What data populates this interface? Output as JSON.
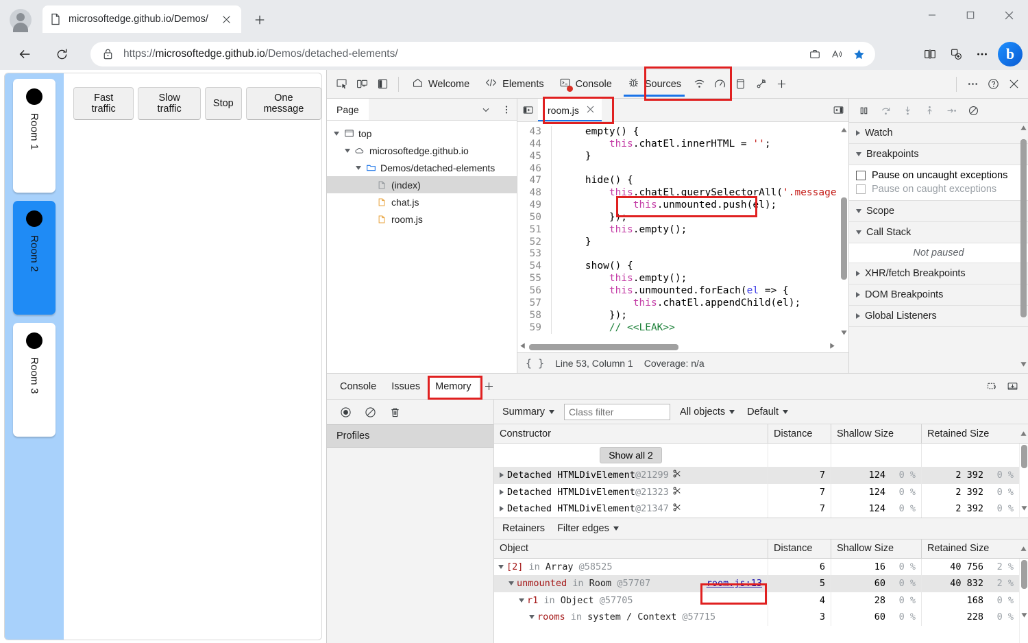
{
  "browser": {
    "tab": {
      "title": "microsoftedge.github.io/Demos/",
      "favicon_icon": "page-icon",
      "close_icon": "close-icon"
    },
    "new_tab_icon": "plus-icon",
    "window_controls": {
      "minimize": "minimize-icon",
      "maximize": "maximize-icon",
      "close": "close-icon"
    },
    "back_icon": "back-arrow-icon",
    "reload_icon": "reload-icon",
    "lock_icon": "lock-icon",
    "url": {
      "scheme": "https://",
      "host": "microsoftedge.github.io",
      "path": "/Demos/detached-elements/"
    },
    "omnibox_icons": [
      "briefcase-icon",
      "read-aloud-icon",
      "favorite-star-icon"
    ],
    "toolbar_icons": [
      "split-screen-icon",
      "collections-icon",
      "more-options-icon"
    ],
    "copilot_icon": "bing-copilot-icon"
  },
  "page": {
    "controls": [
      {
        "label": "Fast traffic"
      },
      {
        "label": "Slow traffic"
      },
      {
        "label": "Stop"
      },
      {
        "label": "One message"
      }
    ],
    "rooms": [
      {
        "label": "Room 1",
        "active": false
      },
      {
        "label": "Room 2",
        "active": true
      },
      {
        "label": "Room 3",
        "active": false
      }
    ],
    "rail_color": "#a8d1fb",
    "active_room_color": "#1f8bf5"
  },
  "devtools": {
    "left_icons": [
      "inspect-element-icon",
      "device-toolbar-icon",
      "dock-side-icon"
    ],
    "tabs": [
      {
        "label": "Welcome",
        "icon": "home-icon",
        "selected": false
      },
      {
        "label": "Elements",
        "icon": "code-brackets-icon",
        "selected": false
      },
      {
        "label": "Console",
        "icon": "console-error-icon",
        "selected": false
      },
      {
        "label": "Sources",
        "icon": "bug-icon",
        "selected": true
      }
    ],
    "extra_tab_icons": [
      "network-icon",
      "performance-icon",
      "application-icon",
      "dom-leak-icon",
      "add-panel-icon"
    ],
    "right_icons": [
      "more-tools-icon",
      "help-icon",
      "close-devtools-icon"
    ],
    "accent_color": "#1a73e8",
    "highlight_color": "#e02020",
    "sources": {
      "nav_tab": "Page",
      "nav_dropdown_icon": "chevron-down-icon",
      "nav_more_icon": "more-vertical-icon",
      "tree": [
        {
          "label": "top",
          "icon": "frame-icon",
          "depth": 0,
          "expanded": true,
          "selected": false
        },
        {
          "label": "microsoftedge.github.io",
          "icon": "cloud-icon",
          "depth": 1,
          "expanded": true,
          "selected": false
        },
        {
          "label": "Demos/detached-elements",
          "icon": "folder-icon",
          "depth": 2,
          "expanded": true,
          "selected": false
        },
        {
          "label": "(index)",
          "icon": "document-icon",
          "depth": 3,
          "expanded": null,
          "selected": true
        },
        {
          "label": "chat.js",
          "icon": "js-file-icon",
          "depth": 3,
          "expanded": null,
          "selected": false
        },
        {
          "label": "room.js",
          "icon": "js-file-icon",
          "depth": 3,
          "expanded": null,
          "selected": false
        }
      ],
      "editor_tab": {
        "label": "room.js",
        "close_icon": "close-icon"
      },
      "panel_toggle_left_icon": "show-navigator-icon",
      "panel_toggle_right_icon": "show-debugger-icon",
      "code_lines": [
        {
          "n": 43,
          "html": "    empty() {"
        },
        {
          "n": 44,
          "html": "        <s class=\"k-this\">this</s>.chatEl.innerHTML = <s class=\"k-str\">''</s>;"
        },
        {
          "n": 45,
          "html": "    }"
        },
        {
          "n": 46,
          "html": ""
        },
        {
          "n": 47,
          "html": "    hide() {"
        },
        {
          "n": 48,
          "html": "        <s class=\"k-this\">this</s>.chatEl.querySelectorAll(<s class=\"k-str\">'.message'</s>)"
        },
        {
          "n": 49,
          "html": "            <s class=\"k-this\">this</s>.unmounted.push(el);"
        },
        {
          "n": 50,
          "html": "        });"
        },
        {
          "n": 51,
          "html": "        <s class=\"k-this\">this</s>.empty();"
        },
        {
          "n": 52,
          "html": "    }"
        },
        {
          "n": 53,
          "html": ""
        },
        {
          "n": 54,
          "html": "    show() {"
        },
        {
          "n": 55,
          "html": "        <s class=\"k-this\">this</s>.empty();"
        },
        {
          "n": 56,
          "html": "        <s class=\"k-this\">this</s>.unmounted.forEach(<s class=\"k-var\">el</s> => {"
        },
        {
          "n": 57,
          "html": "            <s class=\"k-this\">this</s>.chatEl.appendChild(el);"
        },
        {
          "n": 58,
          "html": "        });"
        },
        {
          "n": 59,
          "html": "        <s class=\"k-cmt\">// &lt;&lt;LEAK&gt;&gt;</s>"
        }
      ],
      "status": {
        "pretty_print_icon": "{ }",
        "position": "Line 53, Column 1",
        "coverage": "Coverage: n/a"
      },
      "debugger_toolbar_icons": [
        "pause-resume-icon",
        "step-over-icon",
        "step-into-icon",
        "step-out-icon",
        "step-icon",
        "deactivate-breakpoints-icon"
      ],
      "debugger_sections": [
        {
          "label": "Watch",
          "expanded": false
        },
        {
          "label": "Breakpoints",
          "expanded": true
        },
        {
          "label": "Scope",
          "expanded": true
        },
        {
          "label": "Call Stack",
          "expanded": true
        },
        {
          "label": "XHR/fetch Breakpoints",
          "expanded": false
        },
        {
          "label": "DOM Breakpoints",
          "expanded": false
        },
        {
          "label": "Global Listeners",
          "expanded": false
        }
      ],
      "breakpoint_options": [
        {
          "label": "Pause on uncaught exceptions",
          "checked": false,
          "enabled": true
        },
        {
          "label": "Pause on caught exceptions",
          "checked": false,
          "enabled": false
        }
      ],
      "call_stack_empty": "Not paused"
    },
    "drawer": {
      "tabs": [
        {
          "label": "Console",
          "selected": false
        },
        {
          "label": "Issues",
          "selected": false
        },
        {
          "label": "Memory",
          "selected": true
        }
      ],
      "add_tab_icon": "plus-icon",
      "right_icons": [
        "restore-drawer-icon",
        "dock-drawer-icon"
      ],
      "memory": {
        "toolbar_icons": [
          "record-icon",
          "clear-icon",
          "delete-icon"
        ],
        "sidebar_header": "Profiles",
        "view_select": "Summary",
        "class_filter_placeholder": "Class filter",
        "objects_select": "All objects",
        "base_select": "Default",
        "constructor_columns": [
          "Constructor",
          "Distance",
          "Shallow Size",
          "Retained Size"
        ],
        "show_all_button": "Show all 2",
        "constructor_rows": [
          {
            "name": "Detached HTMLDivElement",
            "id": "@21299",
            "distance": "7",
            "shallow": "124",
            "shallow_pct": "0 %",
            "retained": "2 392",
            "retained_pct": "0 %",
            "selected": true
          },
          {
            "name": "Detached HTMLDivElement",
            "id": "@21323",
            "distance": "7",
            "shallow": "124",
            "shallow_pct": "0 %",
            "retained": "2 392",
            "retained_pct": "0 %",
            "selected": false
          },
          {
            "name": "Detached HTMLDivElement",
            "id": "@21347",
            "distance": "7",
            "shallow": "124",
            "shallow_pct": "0 %",
            "retained": "2 392",
            "retained_pct": "0 %",
            "selected": false
          }
        ],
        "retainers_label": "Retainers",
        "filter_edges_label": "Filter edges",
        "retainer_columns": [
          "Object",
          "Distance",
          "Shallow Size",
          "Retained Size"
        ],
        "retainer_rows": [
          {
            "depth": 0,
            "key": "[2]",
            "in": "in",
            "cls": "Array",
            "id": "@58525",
            "link": "",
            "distance": "6",
            "shallow": "16",
            "shallow_pct": "0 %",
            "retained": "40 756",
            "retained_pct": "2 %",
            "selected": false
          },
          {
            "depth": 1,
            "key": "unmounted",
            "in": "in",
            "cls": "Room",
            "id": "@57707",
            "link": "room.js:13",
            "distance": "5",
            "shallow": "60",
            "shallow_pct": "0 %",
            "retained": "40 832",
            "retained_pct": "2 %",
            "selected": true
          },
          {
            "depth": 2,
            "key": "r1",
            "in": "in",
            "cls": "Object",
            "id": "@57705",
            "link": "",
            "distance": "4",
            "shallow": "28",
            "shallow_pct": "0 %",
            "retained": "168",
            "retained_pct": "0 %",
            "selected": false
          },
          {
            "depth": 3,
            "key": "rooms",
            "in": "in",
            "cls": "system / Context",
            "id": "@57715",
            "link": "",
            "distance": "3",
            "shallow": "60",
            "shallow_pct": "0 %",
            "retained": "228",
            "retained_pct": "0 %",
            "selected": false
          }
        ]
      }
    }
  },
  "annotations": [
    {
      "name": "sources-tab-highlight"
    },
    {
      "name": "room-js-tab-highlight"
    },
    {
      "name": "unmounted-push-line-highlight"
    },
    {
      "name": "memory-tab-highlight"
    },
    {
      "name": "room-js-link-highlight"
    }
  ]
}
